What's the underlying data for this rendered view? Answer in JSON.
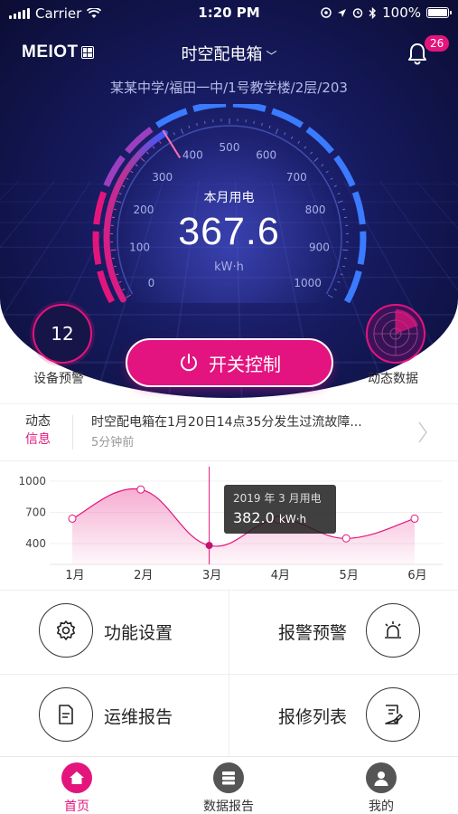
{
  "status_bar": {
    "carrier": "Carrier",
    "time": "1:20 PM",
    "battery": "100%"
  },
  "header": {
    "logo": "MEIOT",
    "title": "时空配电箱",
    "notification_count": "26",
    "breadcrumb": "某某中学/福田一中/1号教学楼/2层/203"
  },
  "gauge": {
    "label": "本月用电",
    "value": "367.6",
    "unit": "kW·h",
    "reading": 367.6,
    "range": [
      0,
      1000
    ],
    "ticks": [
      "0",
      "100",
      "200",
      "300",
      "400",
      "500",
      "600",
      "700",
      "800",
      "900",
      "1000"
    ]
  },
  "actions": {
    "alarm_count": "12",
    "alarm_label": "设备预警",
    "switch_label": "开关控制",
    "dynamic_label": "动态数据"
  },
  "news": {
    "tag_line1": "动态",
    "tag_line2": "信息",
    "text": "时空配电箱在1月20日14点35分发生过流故障...",
    "time": "5分钟前"
  },
  "chart_data": {
    "type": "area",
    "categories": [
      "1月",
      "2月",
      "3月",
      "4月",
      "5月",
      "6月"
    ],
    "x": [
      1,
      2,
      3,
      4,
      5,
      6
    ],
    "values": [
      640,
      920,
      382,
      630,
      450,
      640
    ],
    "yticks": [
      "1000",
      "700",
      "400"
    ],
    "ylim": [
      200,
      1000
    ],
    "highlight_index": 2,
    "tooltip_title": "2019 年 3 月用电",
    "tooltip_value": "382.0",
    "tooltip_unit": "kW·h",
    "color": "#e3157d"
  },
  "menu": {
    "settings": "功能设置",
    "alarm": "报警预警",
    "report": "运维报告",
    "repair": "报修列表"
  },
  "tabs": [
    {
      "label": "首页",
      "active": true
    },
    {
      "label": "数据报告",
      "active": false
    },
    {
      "label": "我的",
      "active": false
    }
  ],
  "colors": {
    "accent": "#e3157d",
    "hero_dark": "#0b0d33",
    "gauge_blue": "#3a7bff"
  }
}
